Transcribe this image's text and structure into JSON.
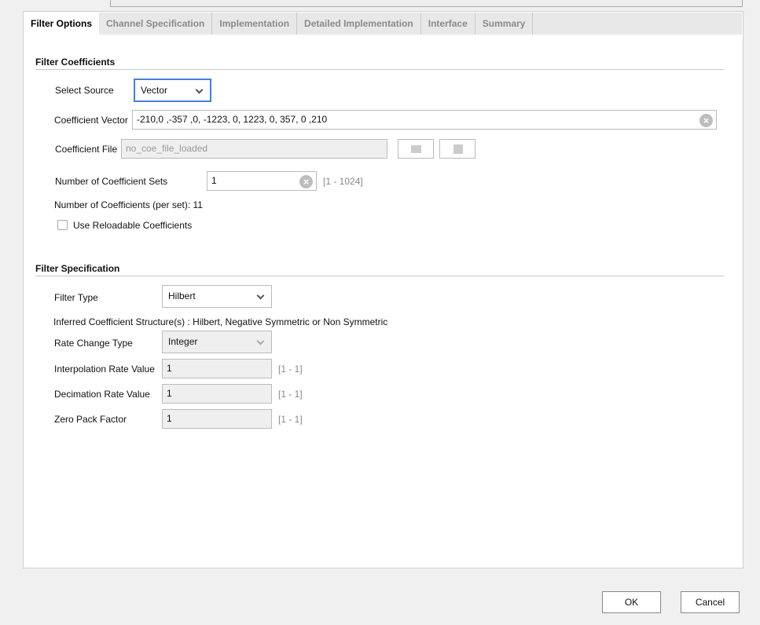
{
  "tabs": [
    "Filter Options",
    "Channel Specification",
    "Implementation",
    "Detailed Implementation",
    "Interface",
    "Summary"
  ],
  "coefficients": {
    "title": "Filter Coefficients",
    "select_source_label": "Select Source",
    "select_source_value": "Vector",
    "vector_label": "Coefficient Vector",
    "vector_value": "-210,0 ,-357 ,0, -1223, 0, 1223, 0, 357, 0 ,210",
    "file_label": "Coefficient File",
    "file_value": "no_coe_file_loaded",
    "sets_label": "Number of Coefficient Sets",
    "sets_value": "1",
    "sets_range": "[1 - 1024]",
    "count_text": "Number of Coefficients (per set): 11",
    "reloadable_label": "Use Reloadable Coefficients",
    "reloadable_checked": false
  },
  "spec": {
    "title": "Filter Specification",
    "filter_type_label": "Filter Type",
    "filter_type_value": "Hilbert",
    "inferred_text": "Inferred Coefficient Structure(s) : Hilbert, Negative Symmetric or Non Symmetric",
    "rate_change_label": "Rate Change Type",
    "rate_change_value": "Integer",
    "interp_label": "Interpolation Rate Value",
    "interp_value": "1",
    "interp_range": "[1 - 1]",
    "decim_label": "Decimation Rate Value",
    "decim_value": "1",
    "decim_range": "[1 - 1]",
    "zero_label": "Zero Pack Factor",
    "zero_value": "1",
    "zero_range": "[1 - 1]"
  },
  "buttons": {
    "ok": "OK",
    "cancel": "Cancel"
  },
  "colors": {
    "focus": "#4a7fd4"
  }
}
